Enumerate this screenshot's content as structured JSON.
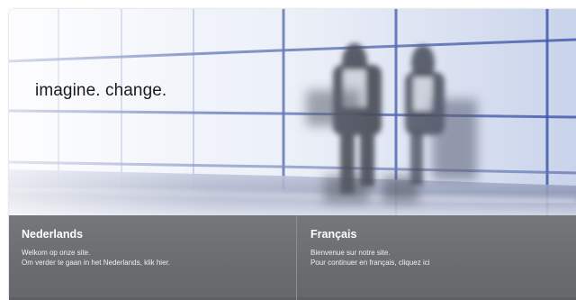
{
  "hero": {
    "tagline": "imagine. change."
  },
  "languages": [
    {
      "title": "Nederlands",
      "line1": "Welkom op onze site.",
      "line2": "Om verder te gaan in het Nederlands, klik hier."
    },
    {
      "title": "Français",
      "line1": "Bienvenue sur notre site.",
      "line2": "Pour continuer en français, cliquez ici"
    }
  ],
  "colors": {
    "panel": "#6d6f73",
    "window_frame": "#2d4a9e",
    "sky": "#e6ecf6"
  }
}
